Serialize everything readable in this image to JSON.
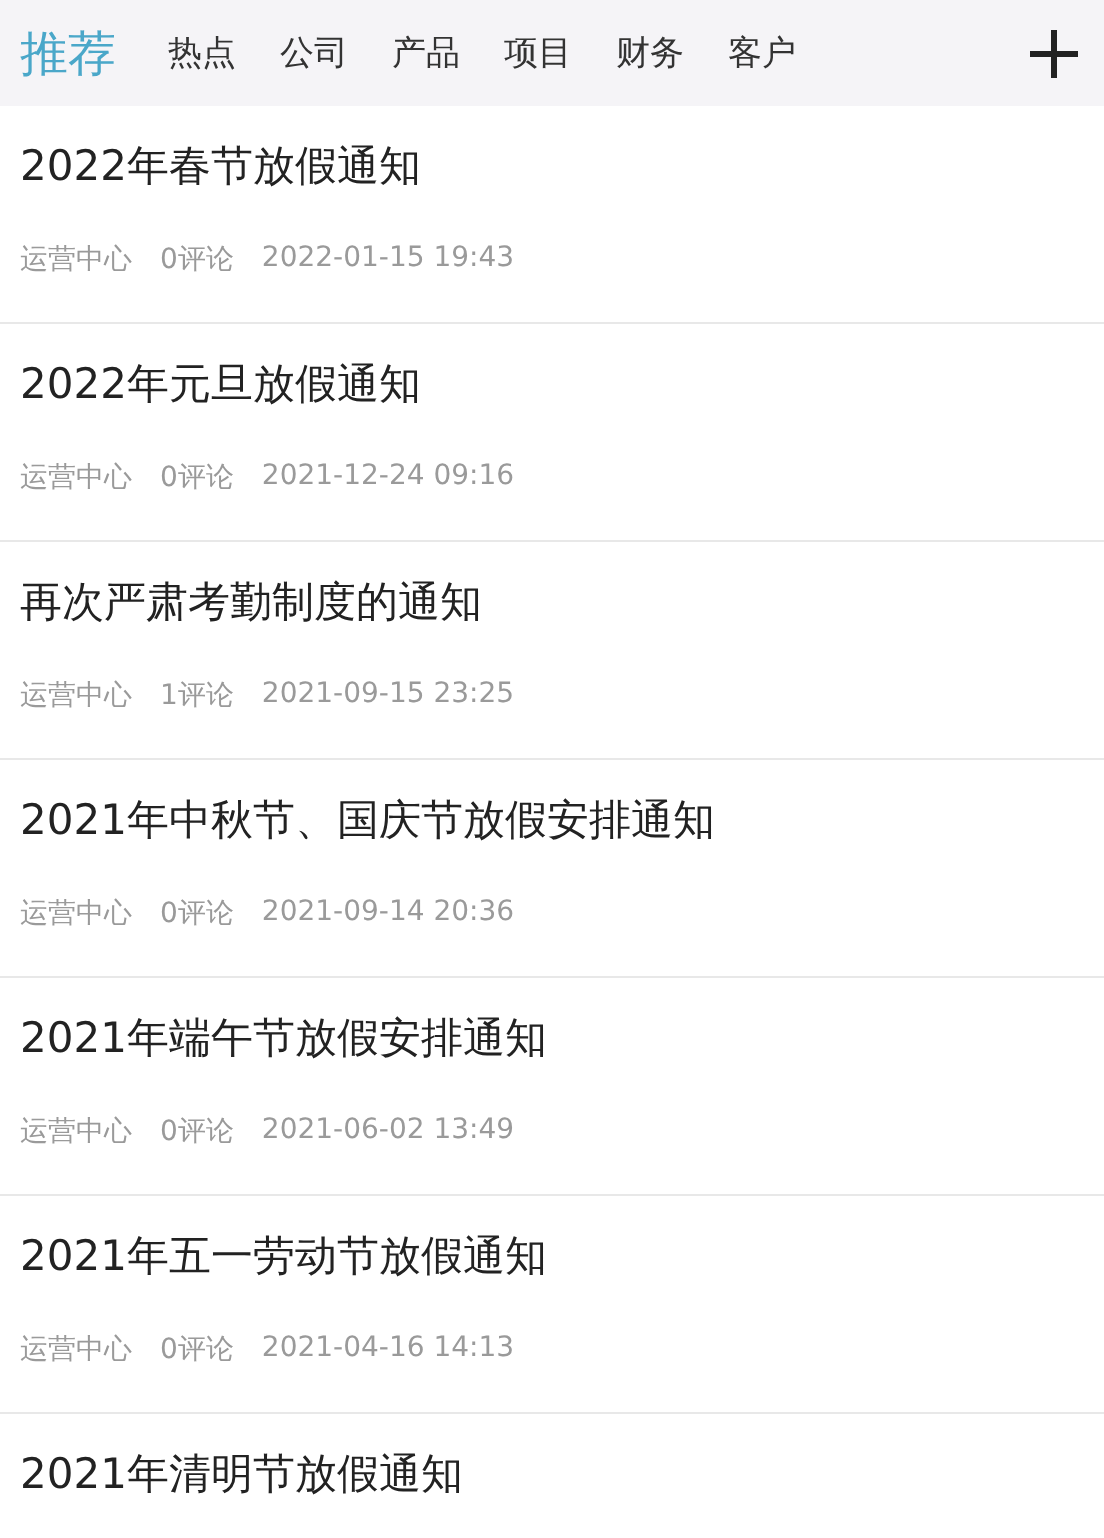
{
  "tabs": [
    {
      "label": "推荐",
      "selected": true
    },
    {
      "label": "热点",
      "selected": false
    },
    {
      "label": "公司",
      "selected": false
    },
    {
      "label": "产品",
      "selected": false
    },
    {
      "label": "项目",
      "selected": false
    },
    {
      "label": "财务",
      "selected": false
    },
    {
      "label": "客户",
      "selected": false
    }
  ],
  "articles": [
    {
      "title": "2022年春节放假通知",
      "source": "运营中心",
      "comments": "0评论",
      "time": "2022-01-15 19:43"
    },
    {
      "title": "2022年元旦放假通知",
      "source": "运营中心",
      "comments": "0评论",
      "time": "2021-12-24 09:16"
    },
    {
      "title": "再次严肃考勤制度的通知",
      "source": "运营中心",
      "comments": "1评论",
      "time": "2021-09-15 23:25"
    },
    {
      "title": "2021年中秋节、国庆节放假安排通知",
      "source": "运营中心",
      "comments": "0评论",
      "time": "2021-09-14 20:36"
    },
    {
      "title": "2021年端午节放假安排通知",
      "source": "运营中心",
      "comments": "0评论",
      "time": "2021-06-02 13:49"
    },
    {
      "title": "2021年五一劳动节放假通知",
      "source": "运营中心",
      "comments": "0评论",
      "time": "2021-04-16 14:13"
    },
    {
      "title": "2021年清明节放假通知"
    }
  ]
}
